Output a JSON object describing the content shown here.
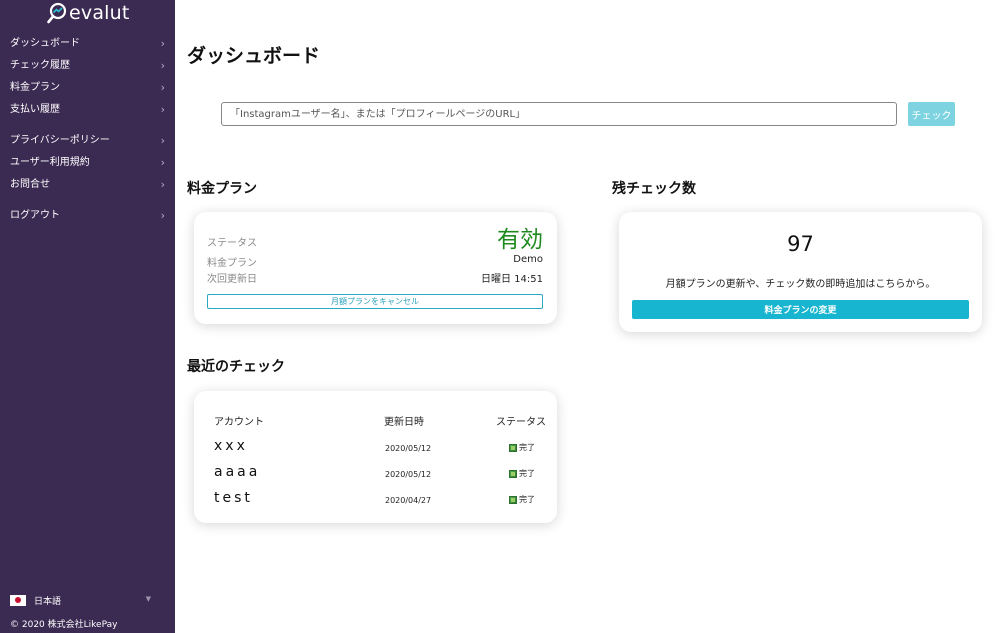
{
  "brand": {
    "name": "evalut",
    "logo_icon": "magnifier-icon"
  },
  "sidebar": {
    "items": [
      {
        "label": "ダッシュボード"
      },
      {
        "label": "チェック履歴"
      },
      {
        "label": "料金プラン"
      },
      {
        "label": "支払い履歴"
      },
      {
        "label": "プライバシーポリシー"
      },
      {
        "label": "ユーザー利用規約"
      },
      {
        "label": "お問合せ"
      },
      {
        "label": "ログアウト"
      }
    ],
    "chevron": "›",
    "language": {
      "label": "日本語",
      "flag": "japan-flag-icon",
      "caret": "▼"
    },
    "copyright": "© 2020 株式会社LikePay"
  },
  "main": {
    "title": "ダッシュボード",
    "search": {
      "placeholder": "「Instagramユーザー名」、または「プロフィールページのURL」",
      "button_label": "チェック"
    },
    "plan": {
      "section_title": "料金プラン",
      "status_label": "ステータス",
      "status_value": "有効",
      "plan_label": "料金プラン",
      "plan_value": "Demo",
      "next_update_label": "次回更新日",
      "next_update_value": "日曜日 14:51",
      "cancel_label": "月額プランをキャンセル"
    },
    "remaining": {
      "section_title": "残チェック数",
      "count": "97",
      "description": "月額プランの更新や、チェック数の即時追加はこちらから。",
      "button_label": "料金プランの変更"
    },
    "recent": {
      "section_title": "最近のチェック",
      "columns": [
        "アカウント",
        "更新日時",
        "ステータス"
      ],
      "rows": [
        {
          "account": "xxx",
          "date": "2020/05/12",
          "status": "完了"
        },
        {
          "account": "aaaa",
          "date": "2020/05/12",
          "status": "完了"
        },
        {
          "account": "test",
          "date": "2020/04/27",
          "status": "完了"
        }
      ]
    }
  },
  "colors": {
    "sidebar_bg": "#3b2a52",
    "accent": "#17b5cf",
    "check_button": "#7ed3e0",
    "status_active": "#1e8a1e"
  }
}
